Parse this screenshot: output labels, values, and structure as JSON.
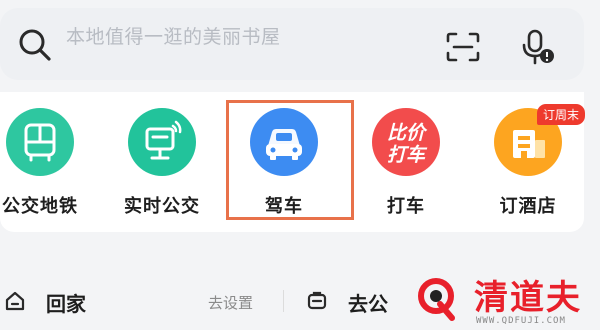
{
  "search": {
    "placeholder": "本地值得一逛的美丽书屋",
    "scan_icon": "scan-icon",
    "voice_icon": "voice-icon"
  },
  "services": [
    {
      "label": "公交地铁",
      "icon": "bus-icon",
      "color": "#2ec7a0"
    },
    {
      "label": "实时公交",
      "icon": "realtime-bus-icon",
      "color": "#22c39b"
    },
    {
      "label": "驾车",
      "icon": "car-icon",
      "color": "#3d8cf2"
    },
    {
      "label": "打车",
      "icon": "taxi-icon",
      "color": "#f24c4c",
      "icon_text": [
        "比价",
        "打车"
      ]
    },
    {
      "label": "订酒店",
      "icon": "hotel-icon",
      "color": "#fda520",
      "badge": "订周末"
    }
  ],
  "highlight_color": "#e8714a",
  "address": {
    "home_label": "回家",
    "home_action": "去设置",
    "work_label": "去公"
  },
  "watermark": {
    "text": "清道夫",
    "url": "WWW.QDFUJI.COM"
  }
}
